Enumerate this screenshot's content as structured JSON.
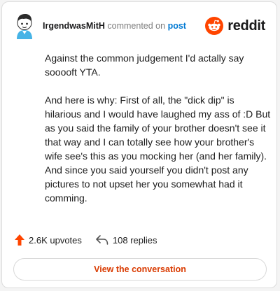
{
  "comment": {
    "username": "IrgendwasMitH",
    "action_text": "commented on",
    "post_link": "post",
    "paragraphs": [
      "Against the common judgement I'd actally say sooooft YTA.",
      "And here is why: First of all, the \"dick dip\" is hilarious and I would have laughed my ass of :D But as you said the family of your brother doesn't see it that way and I can totally see how your brother's wife see's this as you mocking her (and her family). And since you said yourself you didn't post any pictures to not upset her you somewhat had it comming."
    ],
    "upvotes": "2.6K upvotes",
    "replies": "108 replies",
    "view_button": "View the conversation"
  },
  "brand": {
    "name": "reddit",
    "color": "#ff4500"
  },
  "colors": {
    "link": "#0079d3",
    "upvote": "#ff4500",
    "view_button_text": "#d93a00"
  },
  "icons": [
    "avatar",
    "reddit-logo-icon",
    "upvote-arrow-icon",
    "reply-arrow-icon"
  ]
}
